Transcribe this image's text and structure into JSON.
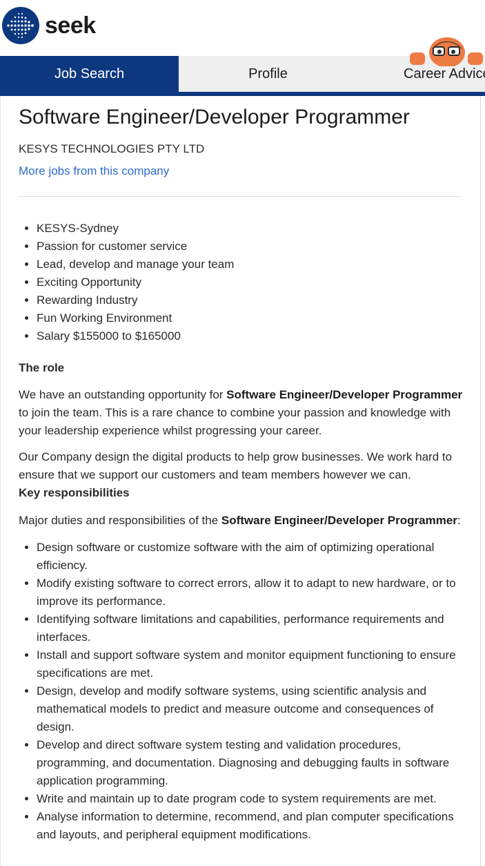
{
  "header": {
    "logo_text": "seek"
  },
  "nav": {
    "tabs": [
      {
        "label": "Job Search",
        "active": true
      },
      {
        "label": "Profile",
        "active": false
      },
      {
        "label": "Career Advice",
        "active": false
      }
    ]
  },
  "job": {
    "title": "Software Engineer/Developer Programmer",
    "company": "KESYS TECHNOLOGIES PTY LTD",
    "more_jobs_link": "More jobs from this company",
    "highlights": [
      "KESYS-Sydney",
      "Passion for customer service",
      "Lead, develop and manage your team",
      "Exciting Opportunity",
      "Rewarding Industry",
      "Fun Working Environment",
      "Salary $155000 to $165000"
    ],
    "role_heading": "The role",
    "p1_before": "We have an outstanding opportunity for ",
    "p1_bold": "Software Engineer/Developer Programmer",
    "p1_after": " to join the team. This is a rare chance to combine your passion and knowledge with your leadership experience whilst progressing your career.",
    "p2": "Our Company design the digital products to help grow businesses. We work hard to ensure that we support our customers and team members however we can.",
    "key_heading": "Key responsibilities",
    "p3_before": "Major duties and responsibilities of the ",
    "p3_bold": "Software Engineer/Developer Programmer",
    "p3_after": ":",
    "duties": [
      "Design software or customize software with the aim of optimizing operational efficiency.",
      "Modify existing software to correct errors, allow it to adapt to new hardware, or to improve its performance.",
      "Identifying software limitations and capabilities, performance requirements and interfaces.",
      "Install and support software system and monitor equipment functioning to ensure specifications are met.",
      "Design, develop and modify software systems, using scientific analysis and mathematical models to predict and measure outcome and consequences of design.",
      "Develop and direct software system testing and validation procedures, programming, and documentation. Diagnosing and debugging faults in software application programming.",
      "Write and maintain up to date program code to system requirements are met.",
      "Analyse information to determine, recommend, and plan computer specifications and layouts, and peripheral equipment modifications."
    ]
  },
  "colors": {
    "brand_navy": "#0d3880",
    "link_blue": "#2e6ac9",
    "mascot_orange": "#ee7c45"
  }
}
